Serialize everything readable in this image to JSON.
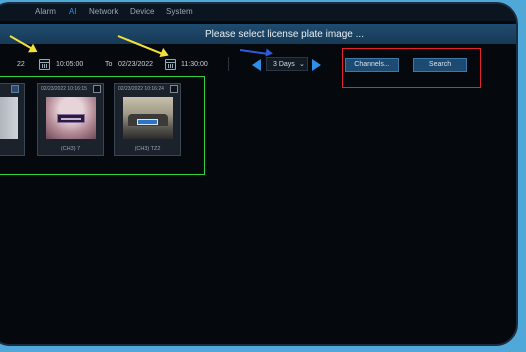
{
  "menu": {
    "items": [
      {
        "label": "Alarm",
        "active": false
      },
      {
        "label": "AI",
        "active": true
      },
      {
        "label": "Network",
        "active": false
      },
      {
        "label": "Device",
        "active": false
      },
      {
        "label": "System",
        "active": false
      }
    ]
  },
  "header": {
    "title": "Please select license plate image ..."
  },
  "search_bar": {
    "start_date_partial": "22",
    "start_time": "10:05:00",
    "to_label": "To",
    "end_date": "02/23/2022",
    "end_time": "11:30:00",
    "range_selected": "3 Days",
    "channels_label": "Channels...",
    "search_label": "Search"
  },
  "results": [
    {
      "timestamp": "02/23/2022 10:16:15",
      "caption": "(CH3) 7"
    },
    {
      "timestamp": "02/23/2022 10:16:24",
      "caption": "(CH3) TZ2"
    }
  ],
  "colors": {
    "accent_blue": "#2f8fe8",
    "annotation_yellow": "#f1e13a",
    "annotation_red": "#e3242b",
    "annotation_green": "#2fd23a",
    "annotation_blue_arrow": "#2f5bd9"
  },
  "icons": {
    "calendar": "calendar-icon",
    "prev": "triangle-left-icon",
    "next": "triangle-right-icon",
    "dropdown": "chevron-down-icon"
  }
}
